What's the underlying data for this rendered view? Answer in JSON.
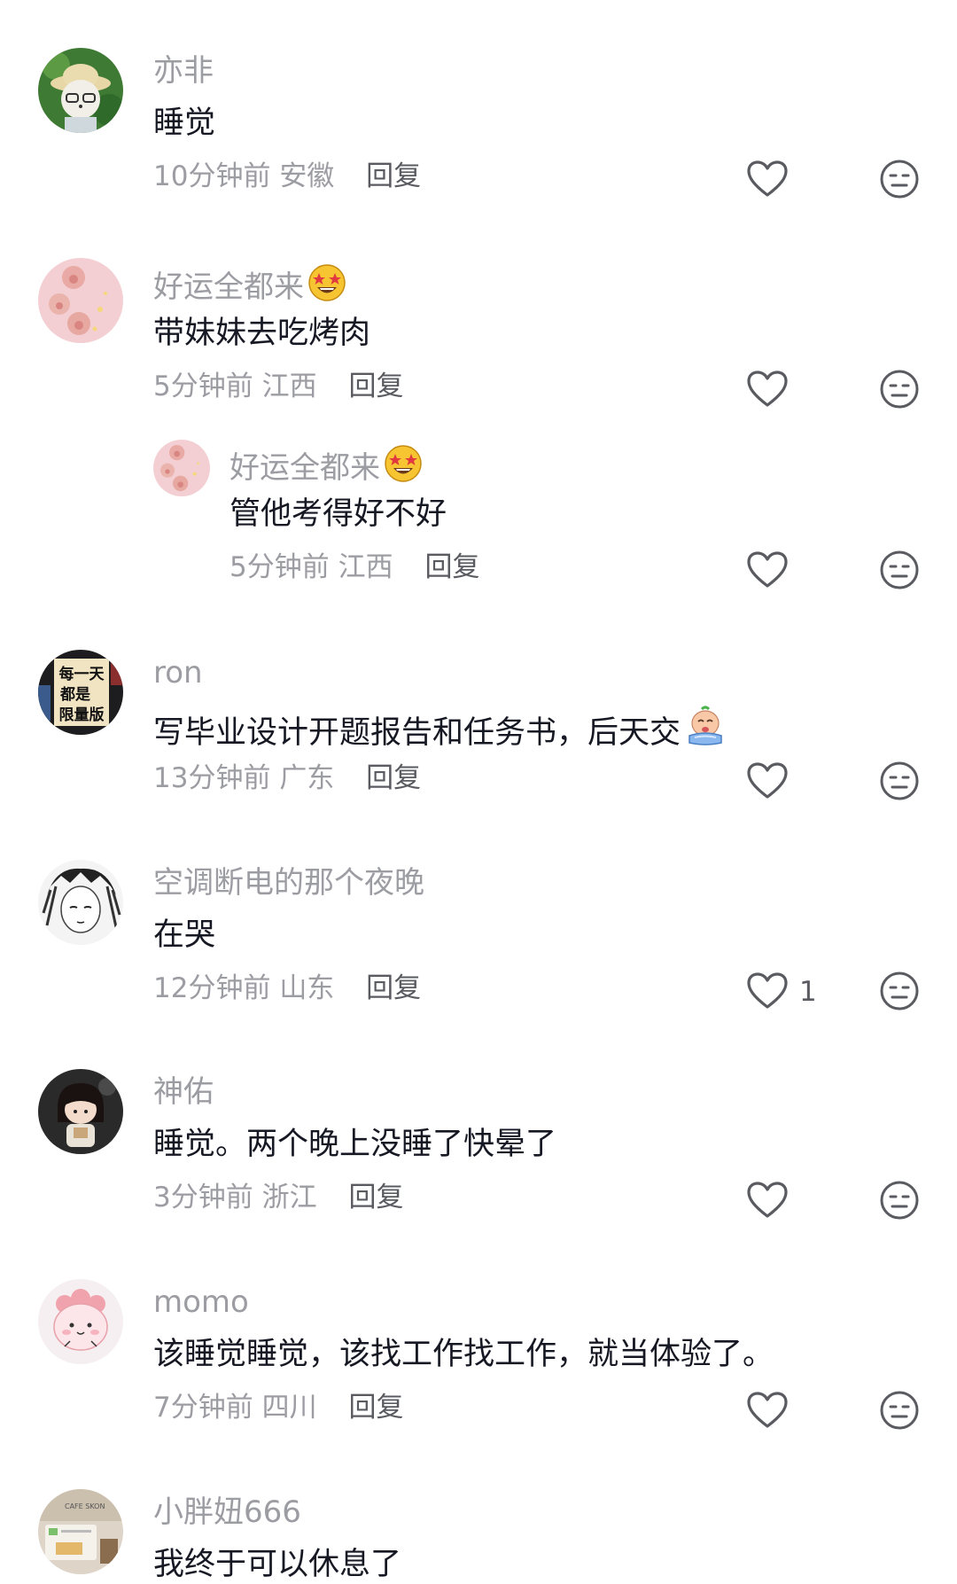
{
  "comments": [
    {
      "user": "亦非",
      "text": "睡觉",
      "time": "10分钟前",
      "region": "安徽",
      "reply": "回复",
      "likes": ""
    },
    {
      "user": "好运全都来",
      "text": "带妹妹去吃烤肉",
      "time": "5分钟前",
      "region": "江西",
      "reply": "回复",
      "likes": ""
    },
    {
      "user": "好运全都来",
      "text": "管他考得好不好",
      "time": "5分钟前",
      "region": "江西",
      "reply": "回复",
      "likes": ""
    },
    {
      "user": "ron",
      "text": "写毕业设计开题报告和任务书，后天交",
      "time": "13分钟前",
      "region": "广东",
      "reply": "回复",
      "likes": ""
    },
    {
      "user": "空调断电的那个夜晚",
      "text": "在哭",
      "time": "12分钟前",
      "region": "山东",
      "reply": "回复",
      "likes": "1"
    },
    {
      "user": "神佑",
      "text": "睡觉。两个晚上没睡了快晕了",
      "time": "3分钟前",
      "region": "浙江",
      "reply": "回复",
      "likes": ""
    },
    {
      "user": "momo",
      "text": "该睡觉睡觉，该找工作找工作，就当体验了。",
      "time": "7分钟前",
      "region": "四川",
      "reply": "回复",
      "likes": ""
    },
    {
      "user": "小胖妞666",
      "text": "我终于可以休息了",
      "time": "",
      "region": "",
      "reply": "",
      "likes": ""
    }
  ],
  "avatar_text": {
    "ron": [
      "每一天",
      "都是",
      "限量版"
    ],
    "xiaopangniu": "CAFE SKON"
  },
  "icons": {
    "like": "heart-outline-icon",
    "dislike": "neutral-face-icon",
    "star_eyes": "star-struck-emoji",
    "crying": "crying-emoji"
  },
  "colors": {
    "name": "#9c9ca3",
    "text": "#161823",
    "reply": "#5a5b61",
    "icon": "#5a5b61"
  }
}
